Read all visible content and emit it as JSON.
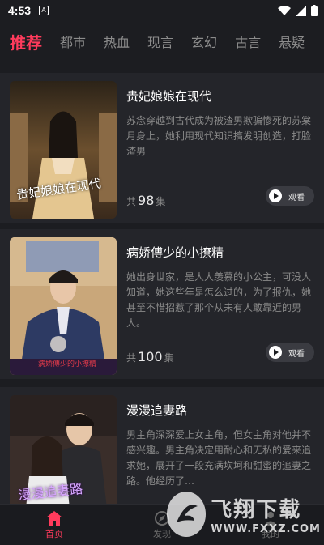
{
  "status_bar": {
    "time": "4:53",
    "notification_icon": "A"
  },
  "tabs": [
    {
      "label": "推荐",
      "active": true
    },
    {
      "label": "都市"
    },
    {
      "label": "热血"
    },
    {
      "label": "现言"
    },
    {
      "label": "玄幻"
    },
    {
      "label": "古言"
    },
    {
      "label": "悬疑"
    }
  ],
  "dramas": [
    {
      "title": "贵妃娘娘在现代",
      "description": "苏念穿越到古代成为被渣男欺骗惨死的苏棠月身上，她利用现代知识搞发明创造，打脸渣男",
      "ep_prefix": "共",
      "episodes": "98",
      "ep_suffix": "集",
      "watch": "观看",
      "cover_caption": "贵妃娘娘在现代"
    },
    {
      "title": "病娇傅少的小撩精",
      "description": "她出身世家，是人人羡慕的小公主，可没人知道，她这些年是怎么过的，为了报仇，她甚至不惜招惹了那个从未有人敢靠近的男人。",
      "ep_prefix": "共",
      "episodes": "100",
      "ep_suffix": "集",
      "watch": "观看",
      "cover_caption": "病娇傅少的小撩精"
    },
    {
      "title": "漫漫追妻路",
      "description": "男主角深深爱上女主角，但女主角对他并不感兴趣。男主角决定用耐心和无私的爱来追求她，展开了一段充满坎坷和甜蜜的追妻之路。他经历了…",
      "cover_caption": "漫漫追妻路"
    }
  ],
  "bottom_nav": [
    {
      "label": "首页",
      "icon": "home-icon",
      "active": true
    },
    {
      "label": "发现",
      "icon": "discover-icon"
    },
    {
      "label": "我的",
      "icon": "profile-icon"
    }
  ],
  "watermark": {
    "brand": "飞翔下载",
    "url": "WWW.FXXZ.COM"
  },
  "colors": {
    "accent": "#ff3b5c",
    "background": "#1c1d21",
    "card": "#24252a"
  }
}
